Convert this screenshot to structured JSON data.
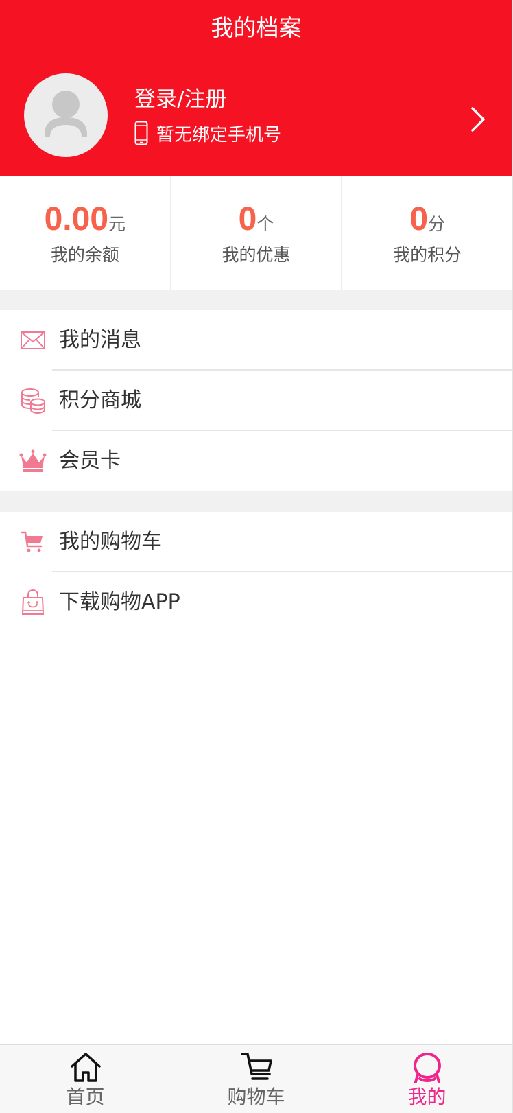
{
  "header": {
    "title": "我的档案",
    "login_label": "登录/注册",
    "phone_status": "暂无绑定手机号",
    "avatar_icon": "user-avatar-icon",
    "phone_icon": "mobile-phone-icon",
    "arrow_icon": "chevron-right-icon",
    "background_color": "#f51323"
  },
  "stats": [
    {
      "value": "0.00",
      "unit": "元",
      "label": "我的余额"
    },
    {
      "value": "0",
      "unit": "个",
      "label": "我的优惠"
    },
    {
      "value": "0",
      "unit": "分",
      "label": "我的积分"
    }
  ],
  "menu_group_1": [
    {
      "label": "我的消息",
      "icon": "envelope-icon"
    },
    {
      "label": "积分商城",
      "icon": "coins-icon"
    },
    {
      "label": "会员卡",
      "icon": "crown-icon"
    }
  ],
  "menu_group_2": [
    {
      "label": "我的购物车",
      "icon": "shopping-cart-icon"
    },
    {
      "label": "下载购物APP",
      "icon": "shopping-bag-icon"
    }
  ],
  "tabbar": {
    "tabs": [
      {
        "label": "首页",
        "icon": "home-icon",
        "active": false
      },
      {
        "label": "购物车",
        "icon": "cart-icon",
        "active": false
      },
      {
        "label": "我的",
        "icon": "profile-icon",
        "active": true
      }
    ],
    "active_color": "#f0258c"
  },
  "colors": {
    "accent_value": "#f6624b",
    "icon_pink": "#f07a92"
  }
}
